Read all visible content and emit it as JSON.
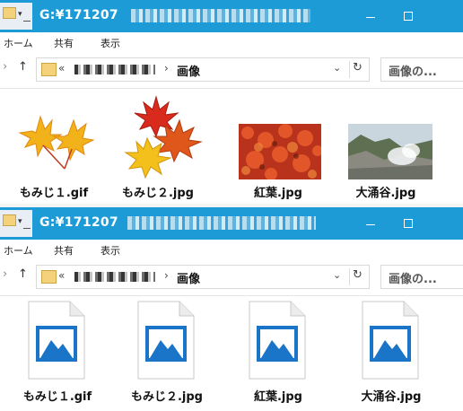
{
  "windows": [
    {
      "title": "G:¥171207",
      "ribbon": {
        "home": "ホーム",
        "share": "共有",
        "view": "表示"
      },
      "address": {
        "prefix": "«",
        "current": "画像",
        "separator": "›"
      },
      "search": {
        "placeholder": "画像の..."
      },
      "files": [
        {
          "name": "もみじ１.gif",
          "thumb": "maple-leaves-yellow"
        },
        {
          "name": "もみじ２.jpg",
          "thumb": "maple-leaves-red-yellow"
        },
        {
          "name": "紅葉.jpg",
          "thumb": "red-foliage-photo"
        },
        {
          "name": "大涌谷.jpg",
          "thumb": "owakudani-landscape-photo"
        }
      ]
    },
    {
      "title": "G:¥171207",
      "ribbon": {
        "home": "ホーム",
        "share": "共有",
        "view": "表示"
      },
      "address": {
        "prefix": "«",
        "current": "画像",
        "separator": "›"
      },
      "search": {
        "placeholder": "画像の..."
      },
      "files": [
        {
          "name": "もみじ１.gif",
          "thumb": "generic-image-file-icon"
        },
        {
          "name": "もみじ２.jpg",
          "thumb": "generic-image-file-icon"
        },
        {
          "name": "紅葉.jpg",
          "thumb": "generic-image-file-icon"
        },
        {
          "name": "大涌谷.jpg",
          "thumb": "generic-image-file-icon"
        }
      ]
    }
  ],
  "colors": {
    "titlebar": "#1c9bd7",
    "imageIconBlue": "#1a74c8"
  }
}
